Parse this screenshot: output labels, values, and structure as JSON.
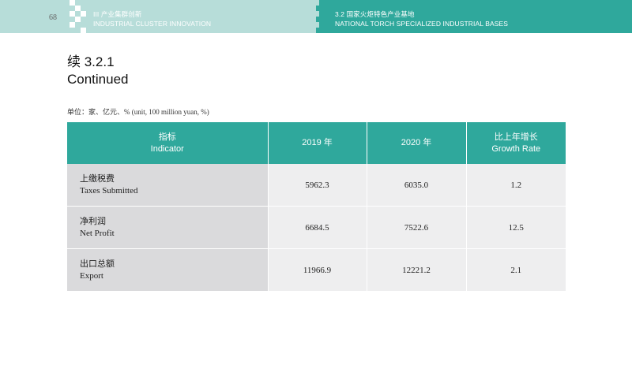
{
  "header": {
    "page_number": "68",
    "left_title_cn": "III  产业集群创新",
    "left_title_en": "INDUSTRIAL CLUSTER INNOVATION",
    "right_title_cn": "3.2  国家火炬特色产业基地",
    "right_title_en": "NATIONAL TORCH SPECIALIZED INDUSTRIAL BASES",
    "colors": {
      "teal": "#2fa89c",
      "light_teal": "#b7ddd9"
    }
  },
  "title": {
    "line1": "续 3.2.1",
    "line2": "Continued"
  },
  "unit_note": "单位：家、亿元、%  (unit, 100 million yuan, %)",
  "table": {
    "headers": [
      {
        "cn": "指标",
        "en": "Indicator"
      },
      {
        "cn": "2019 年",
        "en": ""
      },
      {
        "cn": "2020 年",
        "en": ""
      },
      {
        "cn": "比上年增长",
        "en": "Growth Rate"
      }
    ],
    "rows": [
      {
        "name_cn": "上缴税费",
        "name_en": "Taxes Submitted",
        "y2019": "5962.3",
        "y2020": "6035.0",
        "growth": "1.2"
      },
      {
        "name_cn": "净利润",
        "name_en": "Net Profit",
        "y2019": "6684.5",
        "y2020": "7522.6",
        "growth": "12.5"
      },
      {
        "name_cn": "出口总额",
        "name_en": "Export",
        "y2019": "11966.9",
        "y2020": "12221.2",
        "growth": "2.1"
      }
    ]
  }
}
